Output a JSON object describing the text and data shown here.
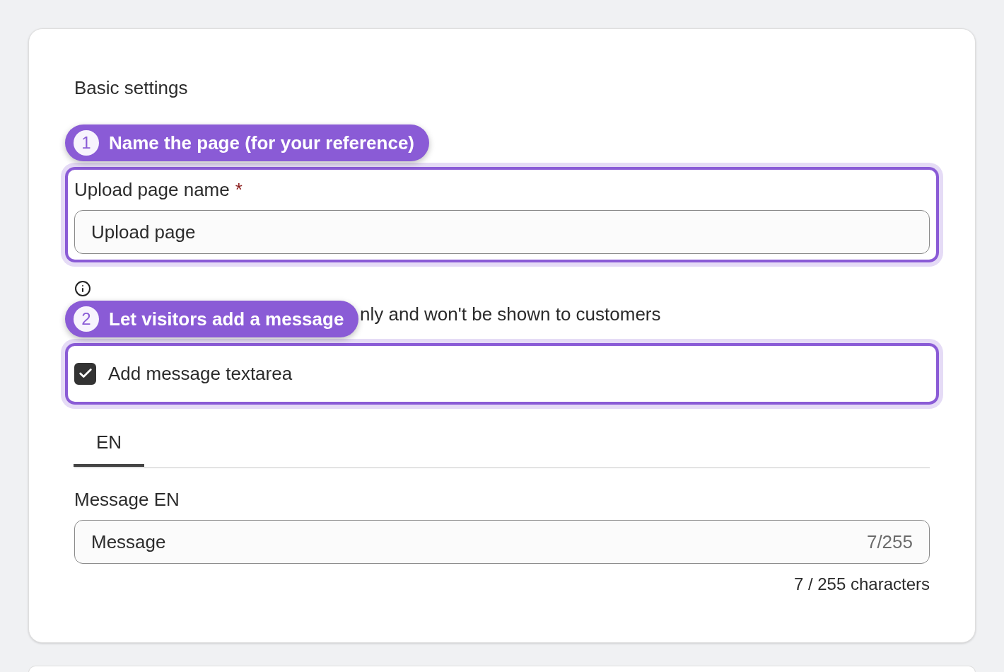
{
  "section": {
    "title": "Basic settings"
  },
  "callouts": [
    {
      "number": "1",
      "text": "Name the page (for your reference)"
    },
    {
      "number": "2",
      "text": "Let visitors add a message"
    }
  ],
  "page_name_field": {
    "label": "Upload page name",
    "required_mark": "*",
    "value": "Upload page"
  },
  "hint": {
    "text": "nly and won't be shown to customers"
  },
  "message_checkbox": {
    "label": "Add message textarea",
    "checked": true
  },
  "language_tabs": [
    {
      "label": "EN",
      "selected": true
    }
  ],
  "message_field": {
    "label": "Message EN",
    "value": "Message",
    "counter": "7/255",
    "helper": "7 / 255 characters"
  }
}
